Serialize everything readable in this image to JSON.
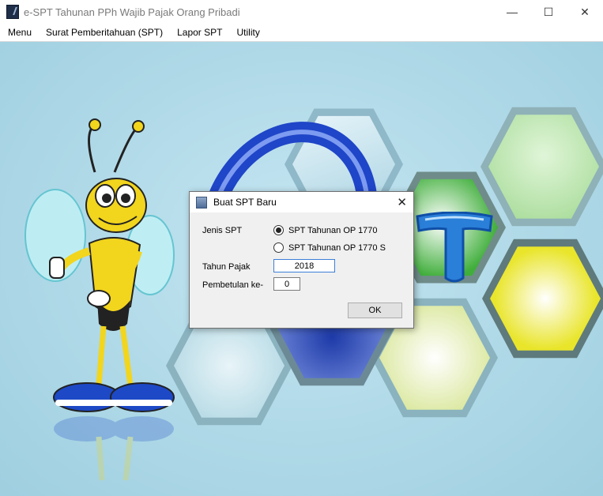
{
  "window": {
    "title": "e-SPT Tahunan PPh Wajib Pajak Orang Pribadi",
    "minimize_glyph": "—",
    "maximize_glyph": "☐",
    "close_glyph": "✕"
  },
  "menu": {
    "items": [
      "Menu",
      "Surat Pemberitahuan (SPT)",
      "Lapor SPT",
      "Utility"
    ]
  },
  "dialog": {
    "title": "Buat SPT Baru",
    "close_glyph": "✕",
    "jenis_label": "Jenis SPT",
    "options": [
      {
        "label": "SPT Tahunan OP 1770",
        "selected": true
      },
      {
        "label": "SPT Tahunan OP 1770 S",
        "selected": false
      }
    ],
    "tahun_label": "Tahun Pajak",
    "tahun_value": "2018",
    "pembetulan_label": "Pembetulan ke-",
    "pembetulan_value": "0",
    "ok_label": "OK"
  },
  "colors": {
    "background": "#b3dbe9",
    "hex_green": "#3fae3a",
    "hex_yellow": "#e9e52b",
    "logo_blue": "#1f45c8"
  },
  "icons": {
    "app": "espt-app-icon",
    "dialog": "document-icon",
    "mascot": "bee-mascot-illustration"
  }
}
